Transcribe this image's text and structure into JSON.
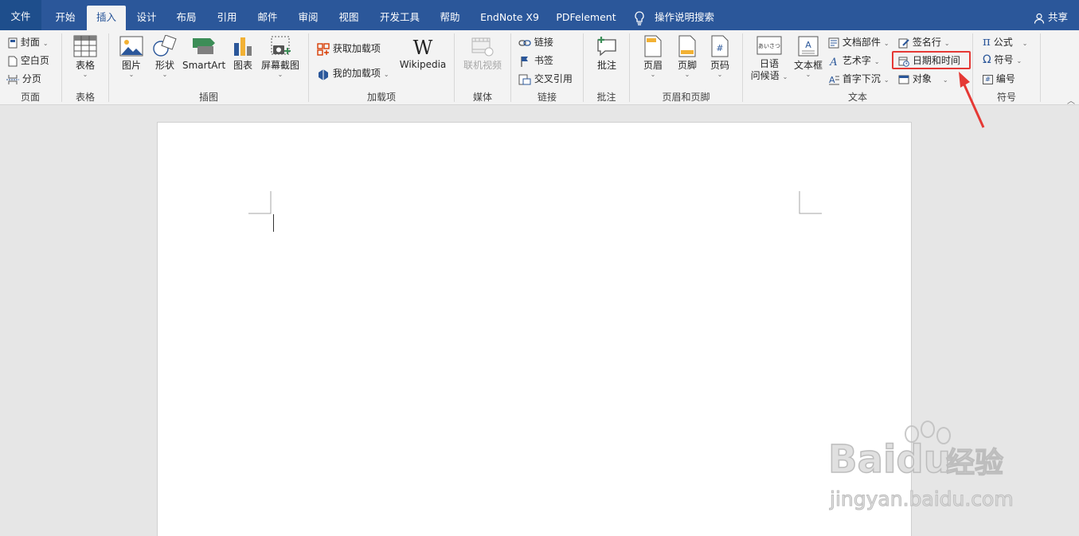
{
  "tabs": {
    "file": "文件",
    "home": "开始",
    "insert": "插入",
    "design": "设计",
    "layout": "布局",
    "references": "引用",
    "mailings": "邮件",
    "review": "审阅",
    "view": "视图",
    "developer": "开发工具",
    "help": "帮助",
    "endnote": "EndNote X9",
    "pdfelement": "PDFelement",
    "tell_me": "操作说明搜索",
    "share": "共享"
  },
  "ribbon": {
    "pages": {
      "cover": "封面",
      "blank": "空白页",
      "break": "分页",
      "label": "页面"
    },
    "tables": {
      "table": "表格",
      "label": "表格"
    },
    "illustrations": {
      "pictures": "图片",
      "shapes": "形状",
      "smartart": "SmartArt",
      "chart": "图表",
      "screenshot": "屏幕截图",
      "label": "插图"
    },
    "addins": {
      "get": "获取加载项",
      "my": "我的加载项",
      "wikipedia": "Wikipedia",
      "wiki_glyph": "W",
      "label": "加载项"
    },
    "media": {
      "online_video": "联机视频",
      "label": "媒体"
    },
    "links": {
      "link": "链接",
      "bookmark": "书签",
      "crossref": "交叉引用",
      "label": "链接"
    },
    "comments": {
      "comment": "批注",
      "label": "批注"
    },
    "header_footer": {
      "header": "页眉",
      "footer": "页脚",
      "page_number": "页码",
      "label": "页眉和页脚"
    },
    "text": {
      "greeting_l1": "日语",
      "greeting_l2": "问候语",
      "greeting_img": "あいさつ",
      "textbox": "文本框",
      "quickparts": "文档部件",
      "wordart": "艺术字",
      "dropcap": "首字下沉",
      "signature": "签名行",
      "datetime": "日期和时间",
      "object": "对象",
      "label": "文本"
    },
    "symbols": {
      "equation": "公式",
      "symbol": "符号",
      "number": "编号",
      "label": "符号",
      "pi": "π",
      "omega": "Ω",
      "hash": "#"
    }
  },
  "watermark": {
    "brand": "Baidu",
    "cn": "经验",
    "url": "jingyan.baidu.com"
  },
  "colors": {
    "tabbar": "#2b579a",
    "ribbon": "#f3f3f3",
    "highlight": "#e53935",
    "canvas": "#e6e6e6"
  }
}
